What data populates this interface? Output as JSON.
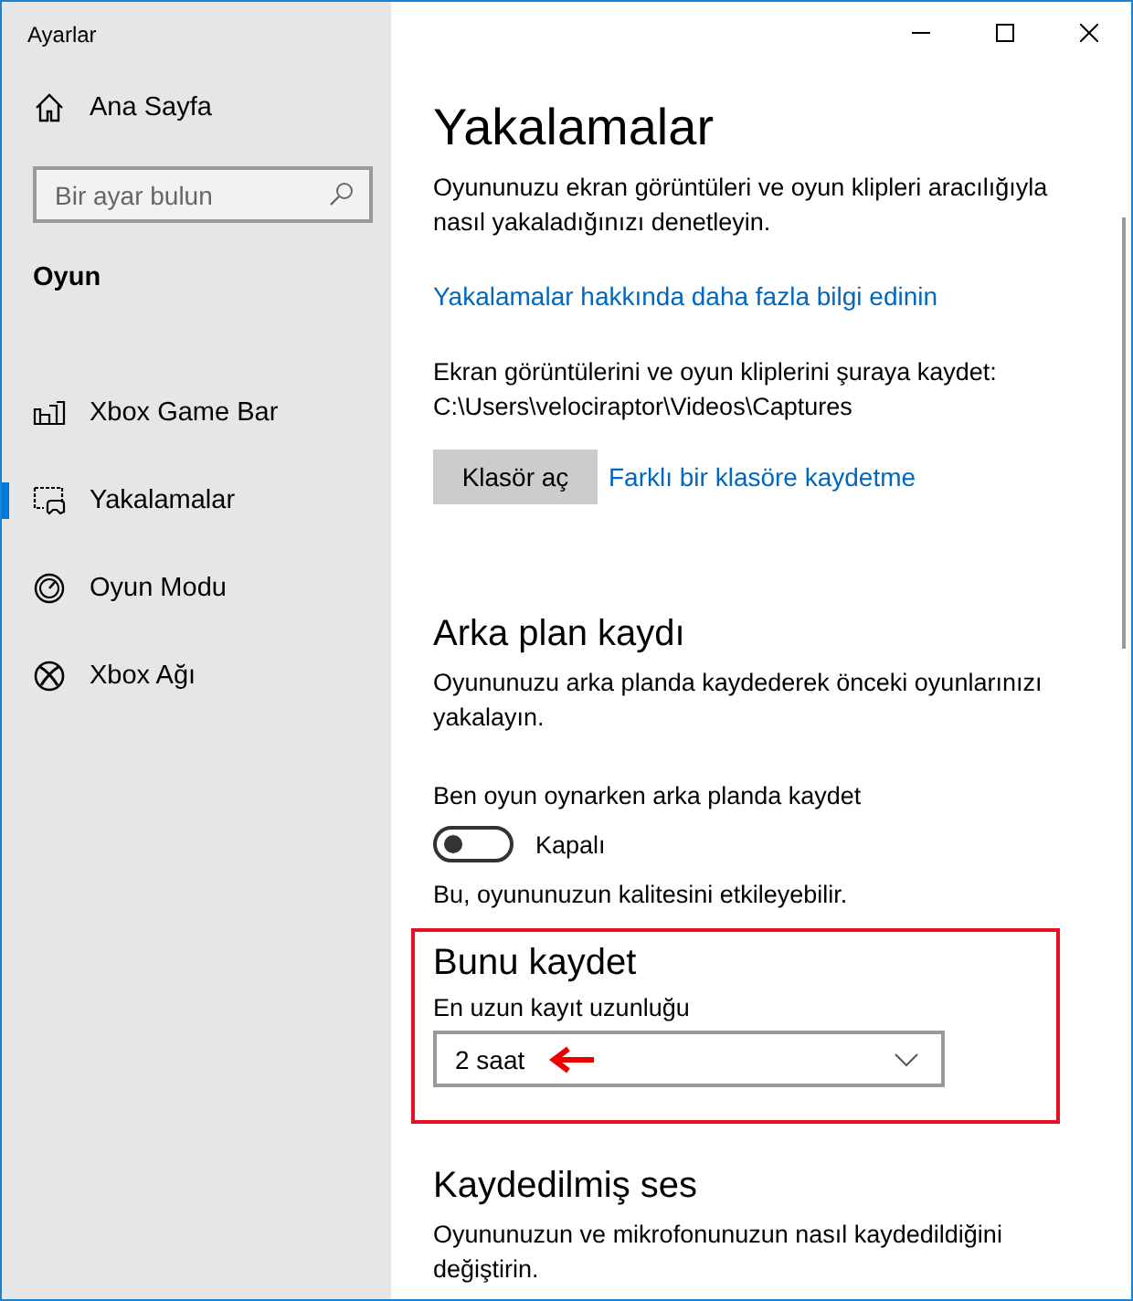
{
  "window": {
    "title": "Ayarlar"
  },
  "sidebar": {
    "home": "Ana Sayfa",
    "search": {
      "placeholder": "Bir ayar bulun"
    },
    "section": "Oyun",
    "items": [
      {
        "label": "Xbox Game Bar",
        "selected": false
      },
      {
        "label": "Yakalamalar",
        "selected": true
      },
      {
        "label": "Oyun Modu",
        "selected": false
      },
      {
        "label": "Xbox Ağı",
        "selected": false
      }
    ]
  },
  "page": {
    "title": "Yakalamalar",
    "description": "Oyununuzu ekran görüntüleri ve oyun klipleri aracılığıyla nasıl yakaladığınızı denetleyin.",
    "learn_link": "Yakalamalar hakkında daha fazla bilgi edinin",
    "save_path": "Ekran görüntülerini ve oyun kliplerini şuraya kaydet: C:\\Users\\velociraptor\\Videos\\Captures",
    "open_folder_button": "Klasör aç",
    "change_folder_link": "Farklı bir klasöre kaydetme"
  },
  "background_recording": {
    "heading": "Arka plan kaydı",
    "description": "Oyununuzu arka planda kaydederek önceki oyunlarınızı yakalayın.",
    "toggle": {
      "label": "Ben oyun oynarken arka planda kaydet",
      "on": false,
      "state_text": "Kapalı"
    },
    "note": "Bu, oyununuzun kalitesini etkileyebilir."
  },
  "record_this": {
    "heading": "Bunu kaydet",
    "label": "En uzun kayıt uzunluğu",
    "dropdown": {
      "value": "2 saat"
    }
  },
  "recorded_audio": {
    "heading": "Kaydedilmiş ses",
    "description": "Oyununuzun ve mikrofonunuzun nasıl kaydedildiğini değiştirin."
  }
}
